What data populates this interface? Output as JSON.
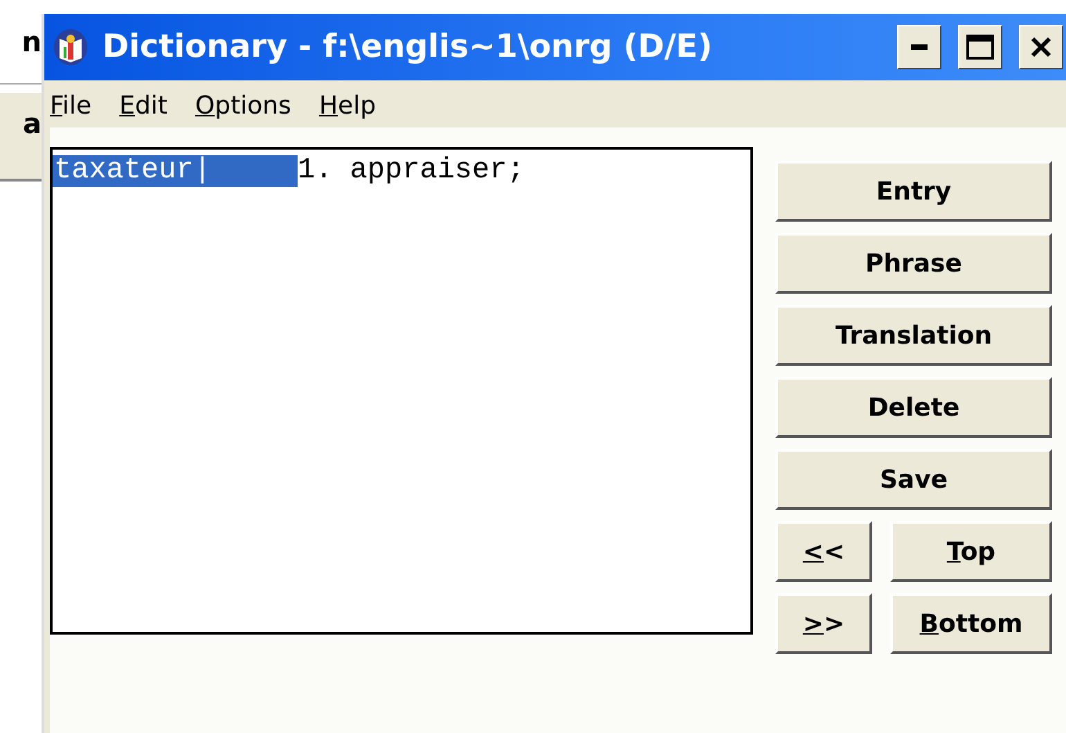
{
  "background_window": {
    "texts": [
      "n",
      "a"
    ]
  },
  "window": {
    "title": "Dictionary - f:\\englis~1\\onrg (D/E)",
    "controls": [
      {
        "kind": "minimize"
      },
      {
        "kind": "maximize"
      },
      {
        "kind": "close"
      }
    ]
  },
  "menu": [
    {
      "key": "F",
      "rest": "ile"
    },
    {
      "key": "E",
      "rest": "dit"
    },
    {
      "key": "O",
      "rest": "ptions"
    },
    {
      "key": "H",
      "rest": "elp"
    }
  ],
  "editor": {
    "headword": "taxateur|",
    "headword_selected": true,
    "definition": "1. appraiser;"
  },
  "buttons": [
    "Entry",
    "Phrase",
    "Translation",
    "Delete",
    "Save"
  ],
  "nav_buttons": [
    [
      {
        "key": "<",
        "rest": "<"
      },
      {
        "key": "T",
        "rest": "op"
      }
    ],
    [
      {
        "key": ">",
        "rest": ">"
      },
      {
        "key": "B",
        "rest": "ottom"
      }
    ]
  ]
}
